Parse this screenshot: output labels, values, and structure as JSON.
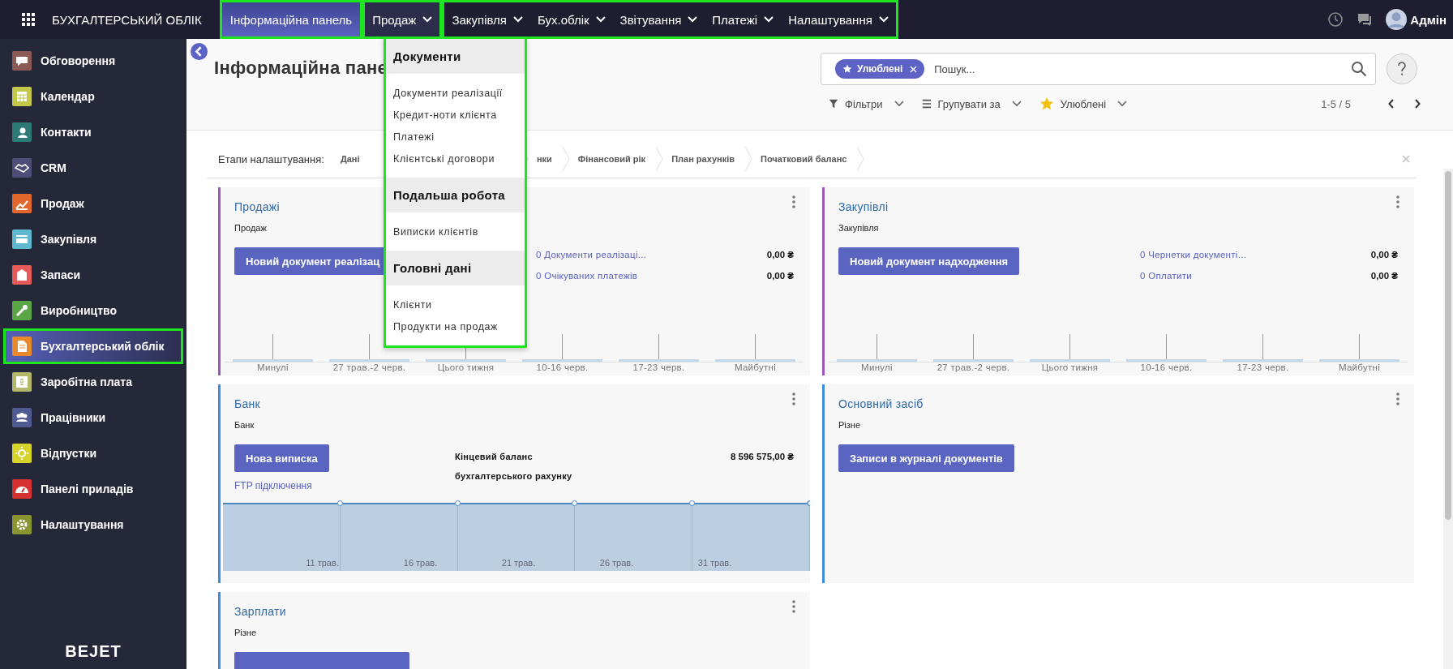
{
  "top_bar": {
    "app_title": "БУХГАЛТЕРСЬКИЙ ОБЛІК",
    "menu_groups": [
      {
        "highlighted": true,
        "items": [
          {
            "label": "Інформаційна панель",
            "kind": "link",
            "selected": true,
            "expanded": false
          }
        ]
      },
      {
        "highlighted": true,
        "items": [
          {
            "label": "Продаж",
            "kind": "menu",
            "selected": false,
            "expanded": true
          }
        ]
      },
      {
        "highlighted": true,
        "items": [
          {
            "label": "Закупівля",
            "kind": "menu",
            "selected": false,
            "expanded": false
          },
          {
            "label": "Бух.облік",
            "kind": "menu",
            "selected": false,
            "expanded": false
          },
          {
            "label": "Звітування",
            "kind": "menu",
            "selected": false,
            "expanded": false
          },
          {
            "label": "Платежі",
            "kind": "menu",
            "selected": false,
            "expanded": false
          },
          {
            "label": "Налаштування",
            "kind": "menu",
            "selected": false,
            "expanded": false
          }
        ]
      }
    ],
    "user": "Адмін"
  },
  "sidebar": {
    "items": [
      {
        "label": "Обговорення",
        "color": "#8b5a55",
        "selected": false,
        "highlighted": false
      },
      {
        "label": "Календар",
        "color": "#c4c84a",
        "selected": false,
        "highlighted": false
      },
      {
        "label": "Контакти",
        "color": "#2d7a78",
        "selected": false,
        "highlighted": false
      },
      {
        "label": "CRM",
        "color": "#4e4c78",
        "selected": false,
        "highlighted": false
      },
      {
        "label": "Продаж",
        "color": "#e1682a",
        "selected": false,
        "highlighted": false
      },
      {
        "label": "Закупівля",
        "color": "#5eb8cf",
        "selected": false,
        "highlighted": false
      },
      {
        "label": "Запаси",
        "color": "#e65a5a",
        "selected": false,
        "highlighted": false
      },
      {
        "label": "Виробництво",
        "color": "#5aa544",
        "selected": false,
        "highlighted": false
      },
      {
        "label": "Бухгалтерський облік",
        "color": "#e88a2c",
        "selected": true,
        "highlighted": true
      },
      {
        "label": "Заробітна плата",
        "color": "#b4b86a",
        "selected": false,
        "highlighted": false
      },
      {
        "label": "Працівники",
        "color": "#4f5a92",
        "selected": false,
        "highlighted": false
      },
      {
        "label": "Відпустки",
        "color": "#d6d42a",
        "selected": false,
        "highlighted": false
      },
      {
        "label": "Панелі приладів",
        "color": "#d63030",
        "selected": false,
        "highlighted": false
      },
      {
        "label": "Налаштування",
        "color": "#8a9530",
        "selected": false,
        "highlighted": false
      }
    ],
    "logo": "BEJET"
  },
  "dropdown": {
    "highlighted": true,
    "sections": [
      {
        "heading": "Документи",
        "items": [
          "Документи реалізації",
          "Кредит-ноти клієнта",
          "Платежі",
          "Клієнтські договори"
        ]
      },
      {
        "heading": "Подальша робота",
        "items": [
          "Виписки клієнтів"
        ]
      },
      {
        "heading": "Головні дані",
        "items": [
          "Клієнти",
          "Продукти на продаж"
        ]
      }
    ]
  },
  "control_panel": {
    "title": "Інформаційна пане",
    "search": {
      "facet": "Улюблені",
      "placeholder": "Пошук..."
    },
    "filters": [
      {
        "label": "Фільтри",
        "kind": "filter"
      },
      {
        "label": "Групувати за",
        "kind": "group"
      },
      {
        "label": "Улюблені",
        "kind": "favorite"
      }
    ],
    "pager": "1-5 / 5"
  },
  "setup_steps": {
    "label": "Етапи налаштування:",
    "steps": [
      "Дані",
      "нки",
      "Фінансовий рік",
      "План рахунків",
      "Початковий баланс"
    ]
  },
  "cards": [
    {
      "title": "Продажі",
      "subtitle": "Продаж",
      "color": "#9b59b6",
      "button": "Новий документ реалізац",
      "button_partial": false,
      "links": [
        {
          "label": "0 Документи реалізаці...",
          "amount": "0,00 ₴",
          "kind": "link"
        },
        {
          "label": "0 Очікуваних платежів",
          "amount": "0,00 ₴",
          "kind": "link"
        }
      ],
      "chart": {
        "kind": "bar",
        "labels": [
          "Минулі",
          "27 трав.-2 черв.",
          "Цього тижня",
          "10-16 черв.",
          "17-23 черв.",
          "Майбутні"
        ]
      }
    },
    {
      "title": "Закупівлі",
      "subtitle": "Закупівля",
      "color": "#9b59b6",
      "button": "Новий документ надходження",
      "button_partial": false,
      "links": [
        {
          "label": "0 Чернетки документі...",
          "amount": "0,00 ₴",
          "kind": "link"
        },
        {
          "label": "0 Оплатити",
          "amount": "0,00 ₴",
          "kind": "link"
        }
      ],
      "chart": {
        "kind": "bar",
        "labels": [
          "Минулі",
          "27 трав.-2 черв.",
          "Цього тижня",
          "10-16 черв.",
          "17-23 черв.",
          "Майбутні"
        ]
      }
    },
    {
      "title": "Банк",
      "subtitle": "Банк",
      "color": "#3c8dde",
      "button": "Нова виписка",
      "button_partial": false,
      "extra_link": "FTP підключення",
      "links": [
        {
          "label": "Кінцевий баланс бухгалтерського рахунку",
          "amount": "8 596 575,00 ₴",
          "kind": "stat"
        }
      ],
      "chart": {
        "kind": "line",
        "labels": [
          "11 трав.",
          "16 трав.",
          "21 трав.",
          "26 трав.",
          "31 трав."
        ]
      }
    },
    {
      "title": "Основний засіб",
      "subtitle": "Різне",
      "color": "#3c8dde",
      "button": "Записи в журналі документів",
      "button_partial": false
    },
    {
      "title": "Зарплати",
      "subtitle": "Різне",
      "color": "#3c8dde",
      "button_partial": true
    }
  ]
}
